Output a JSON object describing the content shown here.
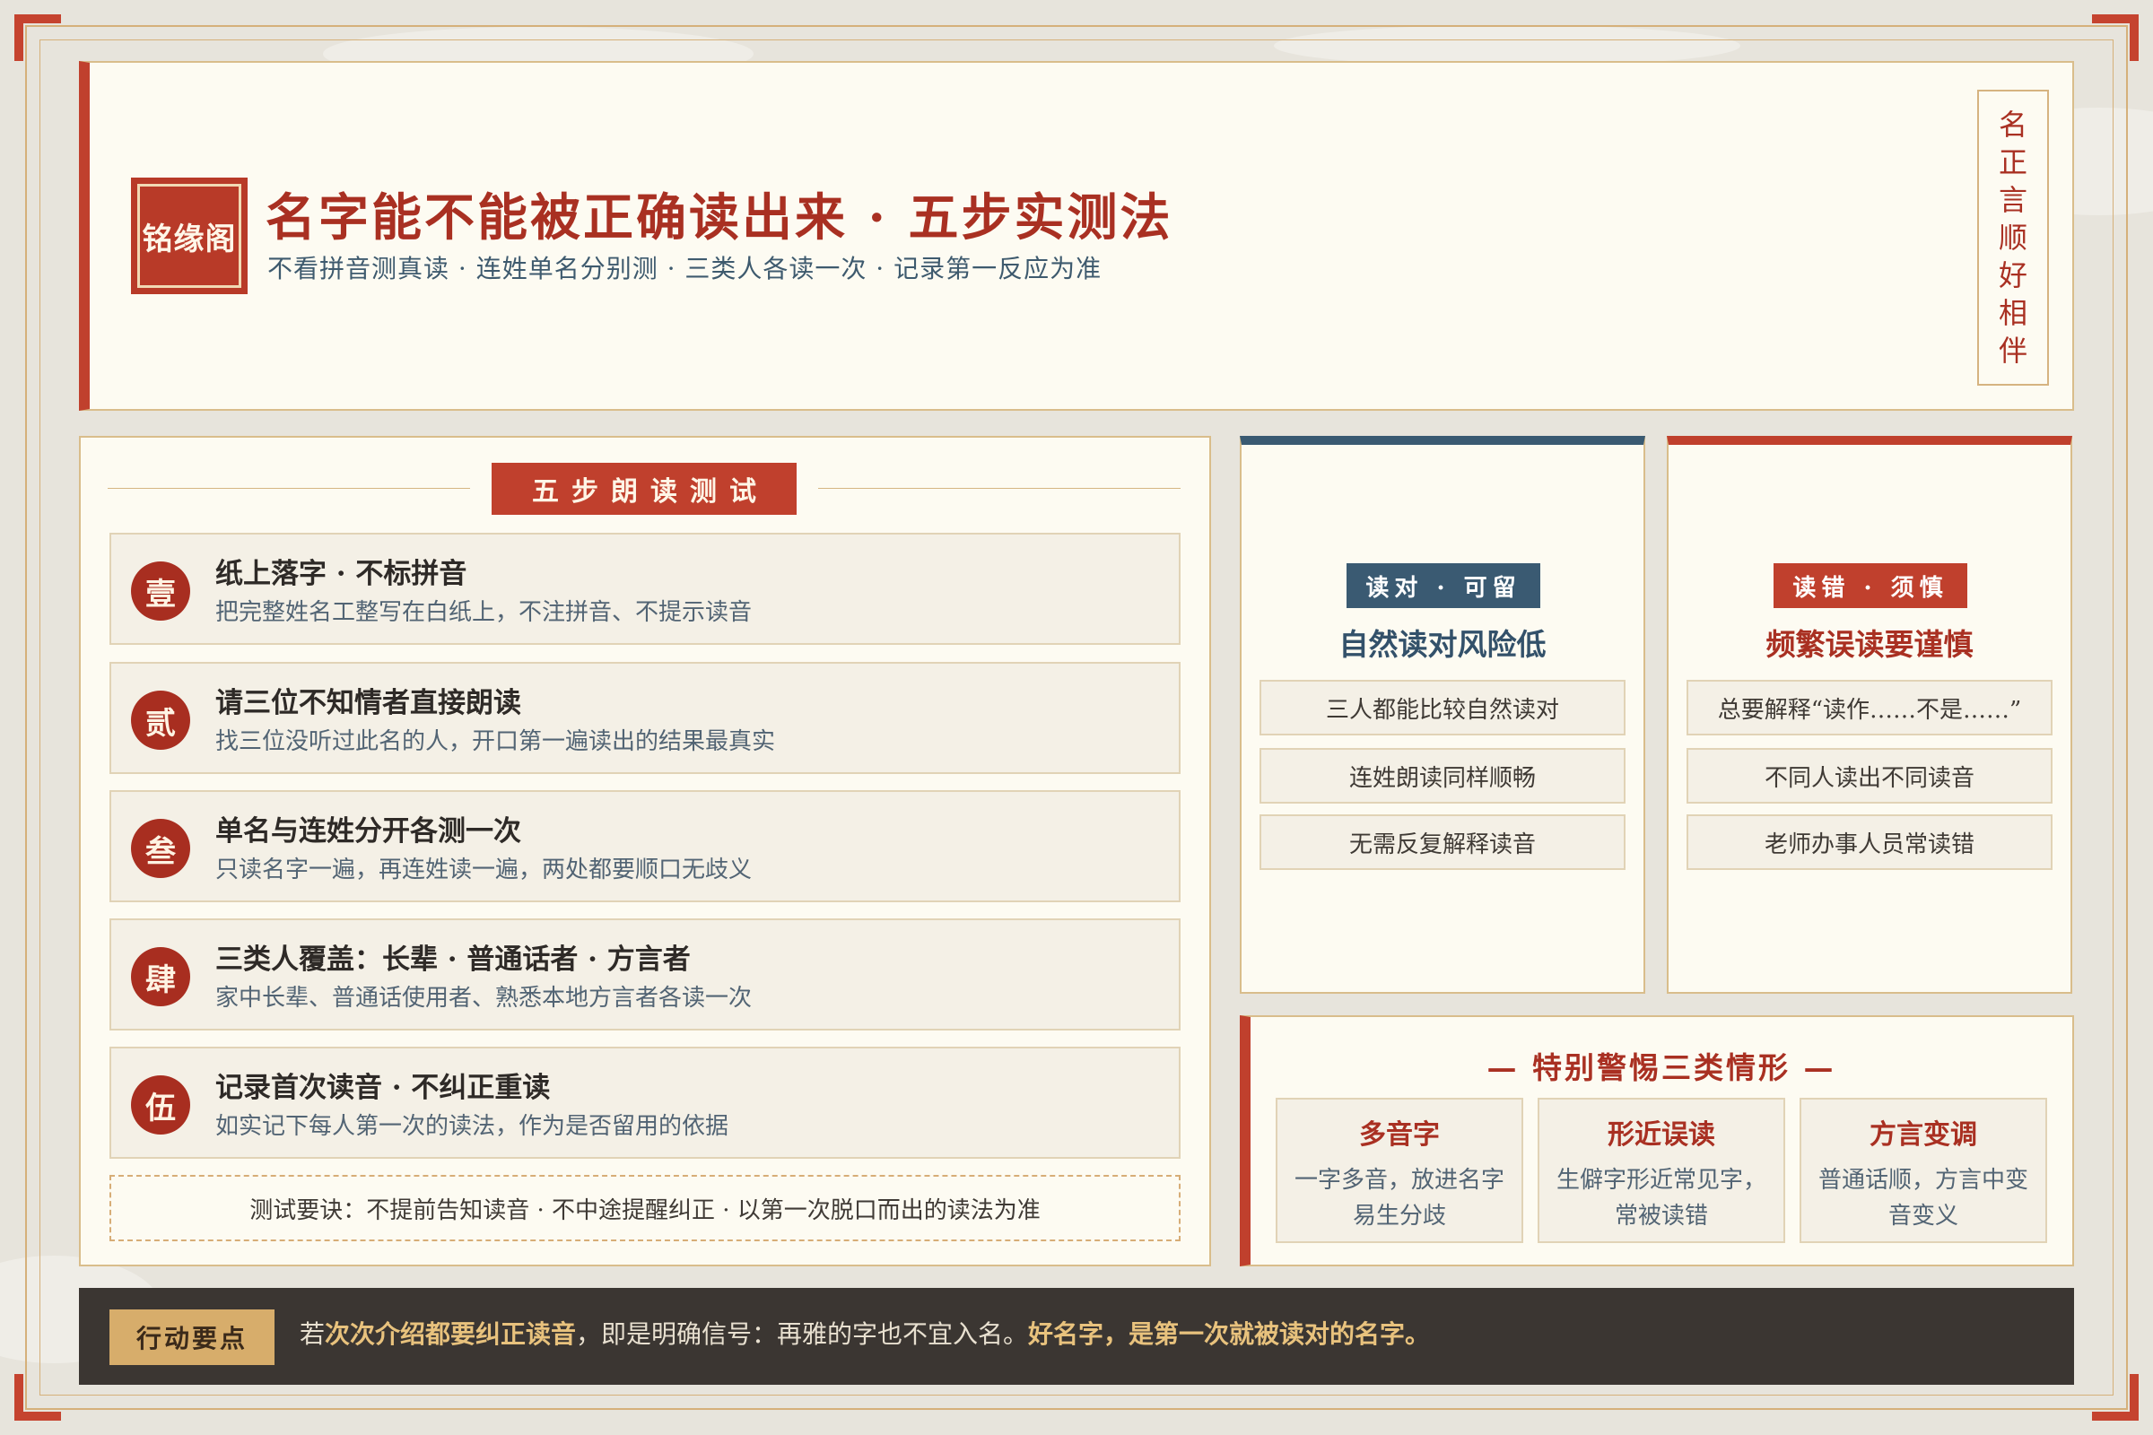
{
  "brand": {
    "seal": "铭缘阁"
  },
  "header": {
    "title": "名字能不能被正确读出来 · 五步实测法",
    "subtitle": "不看拼音测真读 · 连姓单名分别测 · 三类人各读一次 · 记录第一反应为准",
    "motto": [
      "名",
      "正",
      "言",
      "顺",
      "好",
      "相",
      "伴"
    ]
  },
  "steps": {
    "heading": "五步朗读测试",
    "items": [
      {
        "num": "壹",
        "title": "纸上落字 · 不标拼音",
        "desc": "把完整姓名工整写在白纸上，不注拼音、不提示读音"
      },
      {
        "num": "贰",
        "title": "请三位不知情者直接朗读",
        "desc": "找三位没听过此名的人，开口第一遍读出的结果最真实"
      },
      {
        "num": "叁",
        "title": "单名与连姓分开各测一次",
        "desc": "只读名字一遍，再连姓读一遍，两处都要顺口无歧义"
      },
      {
        "num": "肆",
        "title": "三类人覆盖：长辈 · 普通话者 · 方言者",
        "desc": "家中长辈、普通话使用者、熟悉本地方言者各读一次"
      },
      {
        "num": "伍",
        "title": "记录首次读音 · 不纠正重读",
        "desc": "如实记下每人第一次的读法，作为是否留用的依据"
      }
    ],
    "tip": "测试要诀：不提前告知读音 · 不中途提醒纠正 · 以第一次脱口而出的读法为准"
  },
  "correct": {
    "tag": "读对 · 可留",
    "title": "自然读对风险低",
    "items": [
      "三人都能比较自然读对",
      "连姓朗读同样顺畅",
      "无需反复解释读音"
    ]
  },
  "wrong": {
    "tag": "读错 · 须慎",
    "title": "频繁误读要谨慎",
    "items": [
      "总要解释“读作……不是……”",
      "不同人读出不同读音",
      "老师办事人员常读错"
    ]
  },
  "warnings": {
    "title": "— 特别警惕三类情形 —",
    "items": [
      {
        "title": "多音字",
        "desc": "一字多音，放进名字易生分歧"
      },
      {
        "title": "形近误读",
        "desc": "生僻字形近常见字，常被读错"
      },
      {
        "title": "方言变调",
        "desc": "普通话顺，方言中变音变义"
      }
    ]
  },
  "action": {
    "tag": "行动要点",
    "prefix": "若",
    "highlight1": "次次介绍都要纠正读音",
    "middle": "，即是明确信号：再雅的字也不宜入名。",
    "highlight2": "好名字，是第一次就被读对的名字。"
  },
  "colors": {
    "accent_red": "#c0402d",
    "accent_blue": "#3a5a72",
    "gold": "#d7ad6b",
    "dark_bar": "#3b3632"
  }
}
